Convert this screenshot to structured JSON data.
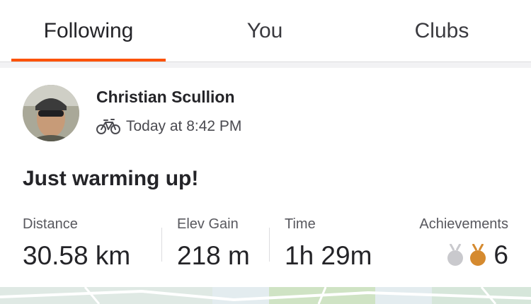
{
  "tabs": [
    {
      "label": "Following",
      "active": true
    },
    {
      "label": "You",
      "active": false
    },
    {
      "label": "Clubs",
      "active": false
    }
  ],
  "colors": {
    "accent": "#fc5200",
    "silver_medal": "#c9c9cd",
    "bronze_medal": "#d58a2f"
  },
  "activity": {
    "athlete_name": "Christian Scullion",
    "activity_icon": "bike-icon",
    "timestamp": "Today at 8:42 PM",
    "title": "Just warming up!",
    "stats": [
      {
        "label": "Distance",
        "value": "30.58 km"
      },
      {
        "label": "Elev Gain",
        "value": "218 m"
      },
      {
        "label": "Time",
        "value": "1h 29m"
      }
    ],
    "achievements": {
      "label": "Achievements",
      "count": "6",
      "icons": [
        "silver-medal-icon",
        "bronze-medal-icon"
      ]
    }
  }
}
